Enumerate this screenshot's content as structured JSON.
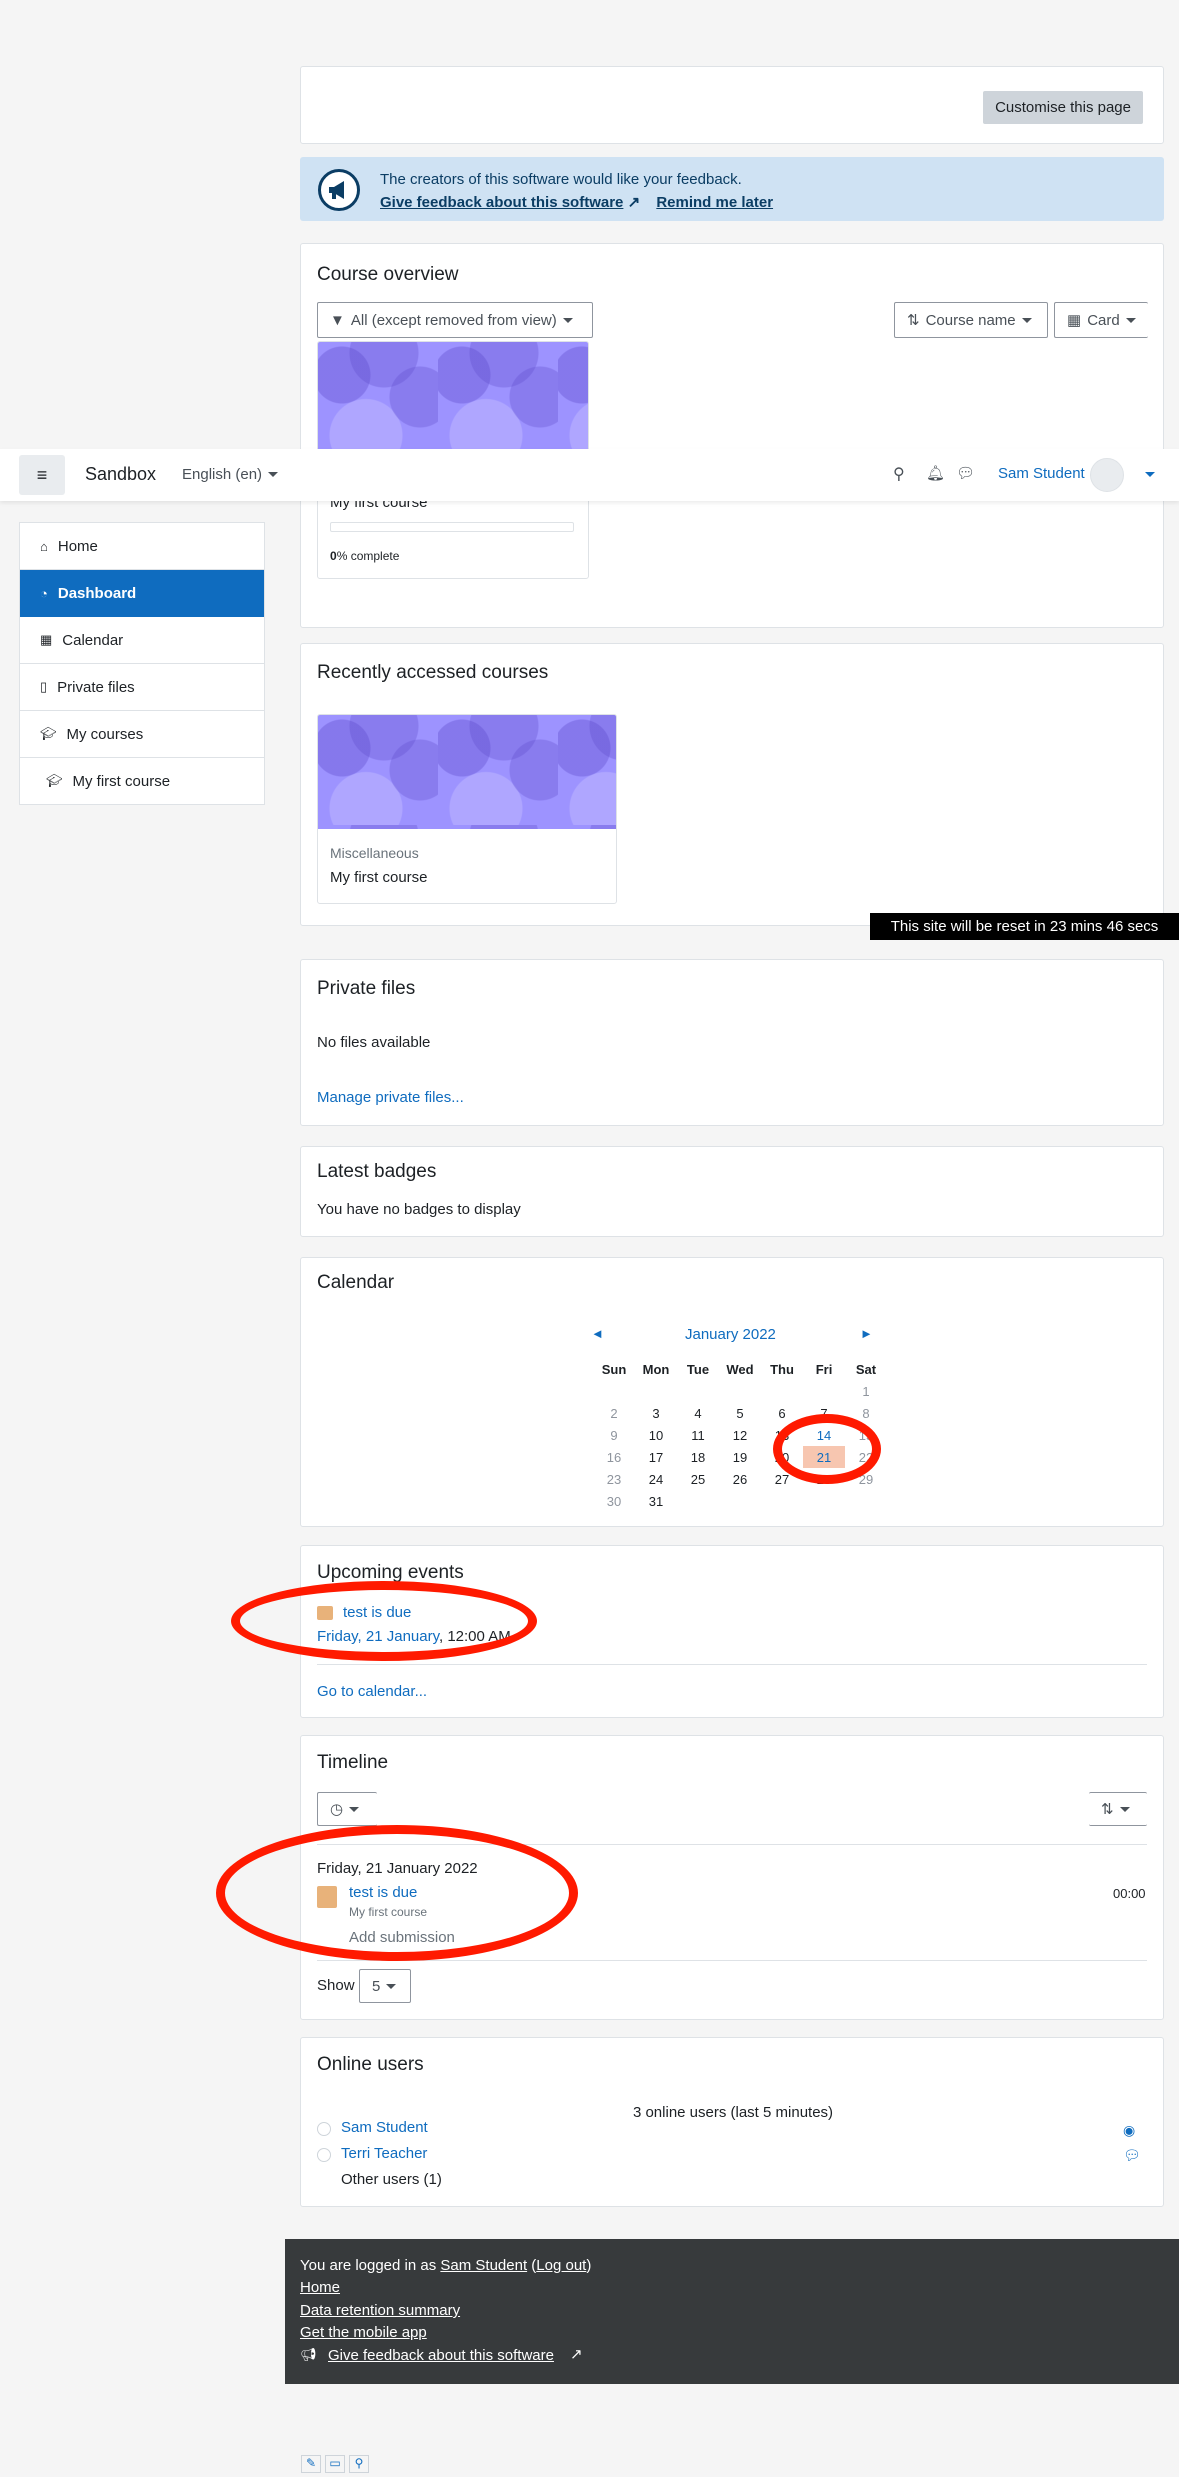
{
  "navbar": {
    "brand": "Sandbox",
    "language": "English (en)",
    "user": "Sam Student"
  },
  "sidebar": {
    "items": [
      {
        "label": "Home",
        "icon": "home-icon"
      },
      {
        "label": "Dashboard",
        "icon": "dashboard-icon",
        "active": true
      },
      {
        "label": "Calendar",
        "icon": "calendar-icon"
      },
      {
        "label": "Private files",
        "icon": "file-icon"
      },
      {
        "label": "My courses",
        "icon": "graduation-cap-icon"
      },
      {
        "label": "My first course",
        "icon": "graduation-cap-icon"
      }
    ]
  },
  "customise": {
    "label": "Customise this page"
  },
  "feedback": {
    "text": "The creators of this software would like your feedback.",
    "link": "Give feedback about this software",
    "remind": "Remind me later"
  },
  "course_overview": {
    "title": "Course overview",
    "filter": "All (except removed from view)",
    "sort": "Course name",
    "view": "Card",
    "course_name": "My first course",
    "progress": "0",
    "progress_suffix": "% complete",
    "progress_value": 0
  },
  "recent": {
    "title": "Recently accessed courses",
    "category": "Miscellaneous",
    "course": "My first course"
  },
  "reset_notice": "This site will be reset in 23 mins 46 secs",
  "private_files": {
    "title": "Private files",
    "empty": "No files available",
    "manage": "Manage private files..."
  },
  "badges": {
    "title": "Latest badges",
    "empty": "You have no badges to display"
  },
  "calendar": {
    "title": "Calendar",
    "month": "January 2022",
    "prev": "◄",
    "next": "►",
    "days": [
      "Sun",
      "Mon",
      "Tue",
      "Wed",
      "Thu",
      "Fri",
      "Sat"
    ],
    "weeks": [
      [
        "",
        "",
        "",
        "",
        "",
        "",
        "1"
      ],
      [
        "2",
        "3",
        "4",
        "5",
        "6",
        "7",
        "8"
      ],
      [
        "9",
        "10",
        "11",
        "12",
        "13",
        "14",
        "15"
      ],
      [
        "16",
        "17",
        "18",
        "19",
        "20",
        "21",
        "22"
      ],
      [
        "23",
        "24",
        "25",
        "26",
        "27",
        "28",
        "29"
      ],
      [
        "30",
        "31",
        "",
        "",
        "",
        "",
        ""
      ]
    ]
  },
  "upcoming": {
    "title": "Upcoming events",
    "event": "test is due",
    "date": "Friday, 21 January",
    "time": ", 12:00 AM",
    "goto": "Go to calendar..."
  },
  "timeline": {
    "title": "Timeline",
    "date_heading": "Friday, 21 January 2022",
    "event": "test is due",
    "course": "My first course",
    "action": "Add submission",
    "time": "00:00",
    "show_label": "Show",
    "show_value": "5"
  },
  "online": {
    "title": "Online users",
    "summary": "3 online users (last 5 minutes)",
    "users": [
      "Sam Student",
      "Terri Teacher"
    ],
    "other": "Other users (1)"
  },
  "footer": {
    "logged_prefix": "You are logged in as ",
    "user": "Sam Student",
    "logout": "Log out",
    "home": "Home",
    "retention": "Data retention summary",
    "mobile": "Get the mobile app",
    "feedback": "Give feedback about this software"
  }
}
